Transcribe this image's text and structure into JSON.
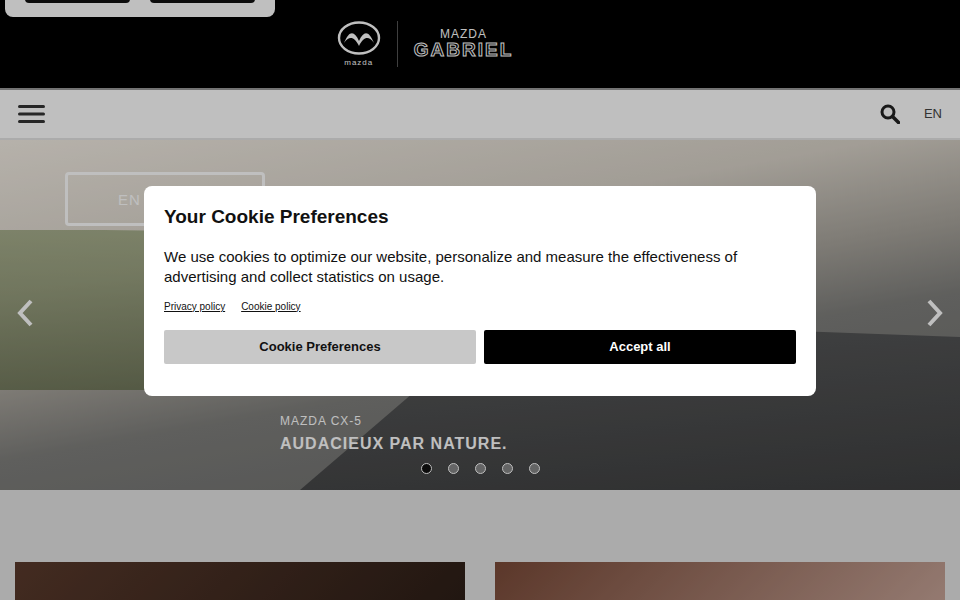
{
  "header": {
    "logo_wordmark": "mazda",
    "dealer_brand": "MAZDA",
    "dealer_name": "GABRIEL"
  },
  "navbar": {
    "language": "EN"
  },
  "hero": {
    "button": "EN",
    "model": "MAZDA CX-5",
    "tagline": "AUDACIEUX PAR NATURE.",
    "slides": [
      {
        "selected": true
      },
      {
        "selected": false
      },
      {
        "selected": false
      },
      {
        "selected": false
      },
      {
        "selected": false
      }
    ]
  },
  "cookie_dialog": {
    "title": "Your Cookie Preferences",
    "text": "We use cookies to optimize our website, personalize and measure the effectiveness of advertising and collect statistics on usage.",
    "links": [
      "Privacy policy",
      "Cookie policy"
    ],
    "buttons": [
      {
        "label": "Cookie Preferences",
        "kind": "secondary"
      },
      {
        "label": "Accept all",
        "kind": "primary"
      }
    ]
  }
}
